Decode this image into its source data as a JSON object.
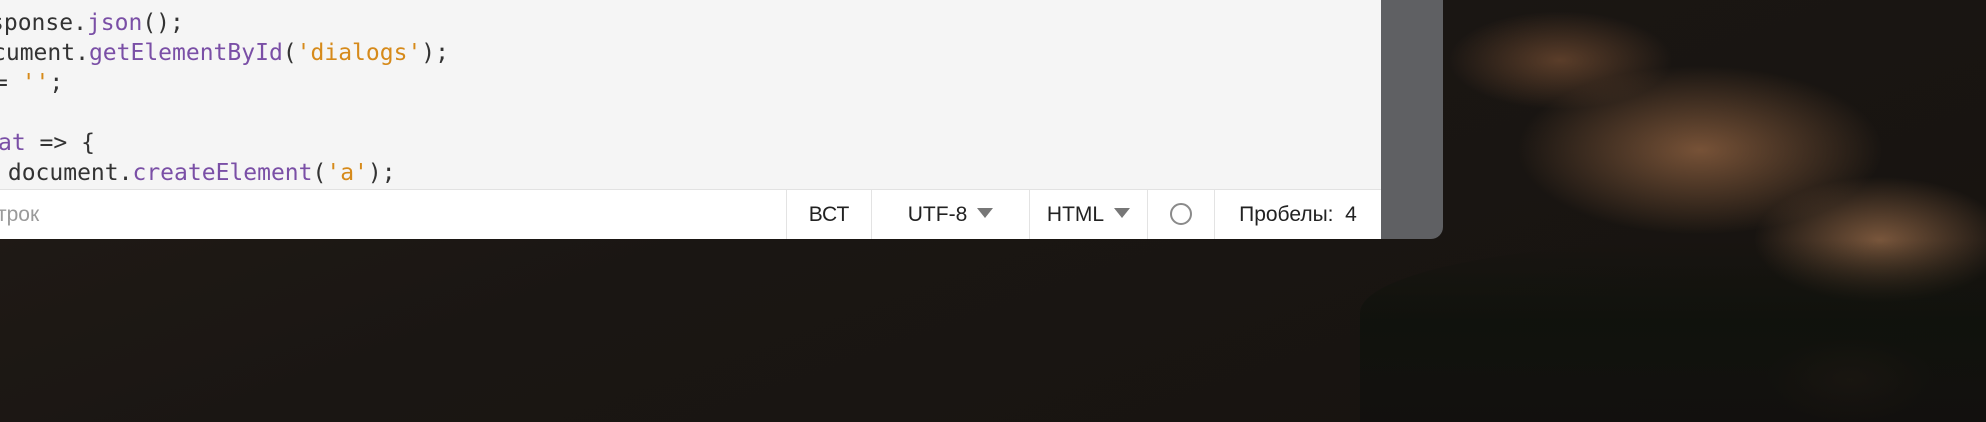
{
  "editor": {
    "code_lines": [
      [
        {
          "t": "sponse."
        },
        {
          "t": "json",
          "c": "fn"
        },
        {
          "t": "();"
        }
      ],
      [
        {
          "t": "cument."
        },
        {
          "t": "getElementById",
          "c": "fn"
        },
        {
          "t": "("
        },
        {
          "t": "'dialogs'",
          "c": "str"
        },
        {
          "t": ");"
        }
      ],
      [
        {
          "t": "= "
        },
        {
          "t": "''",
          "c": "str"
        },
        {
          "t": ";"
        }
      ],
      [],
      [
        {
          "t": "at",
          "c": "kw"
        },
        {
          "t": " => {"
        }
      ],
      [
        {
          "t": " document."
        },
        {
          "t": "createElement",
          "c": "fn"
        },
        {
          "t": "("
        },
        {
          "t": "'a'",
          "c": "str"
        },
        {
          "t": ");"
        }
      ]
    ]
  },
  "statusbar": {
    "cursor_info": "трок",
    "insert_mode": "ВСТ",
    "encoding": "UTF-8",
    "language": "HTML",
    "indent": "Пробелы:  4"
  },
  "colors": {
    "function": "#7a4fa6",
    "string": "#d68a1a",
    "window_frame": "#5f6063"
  }
}
